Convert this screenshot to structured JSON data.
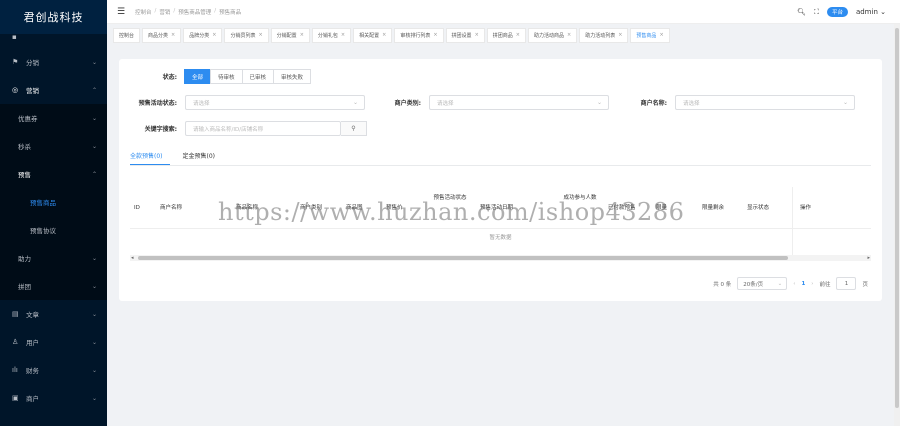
{
  "app": {
    "logo": "君创战科技"
  },
  "sidebar": {
    "items": [
      {
        "label": "分销",
        "icon": "flag-icon"
      },
      {
        "label": "营销",
        "icon": "globe-icon"
      }
    ],
    "marketing_sub": [
      {
        "label": "优惠券"
      },
      {
        "label": "秒杀"
      },
      {
        "label": "预售"
      }
    ],
    "presale_sub": [
      {
        "label": "预售商品"
      },
      {
        "label": "预售协议"
      }
    ],
    "marketing_sub2": [
      {
        "label": "助力"
      },
      {
        "label": "拼团"
      }
    ],
    "items2": [
      {
        "label": "文章",
        "icon": "article-icon"
      },
      {
        "label": "用户",
        "icon": "user-icon"
      },
      {
        "label": "财务",
        "icon": "chart-icon"
      },
      {
        "label": "商户",
        "icon": "shop-icon"
      }
    ]
  },
  "header": {
    "breadcrumb": [
      "控制台",
      "营销",
      "预售商品管理",
      "预售商品"
    ],
    "platform_badge": "平台",
    "user": "admin"
  },
  "tabs": [
    {
      "label": "控制台"
    },
    {
      "label": "商品分类"
    },
    {
      "label": "品牌分类"
    },
    {
      "label": "分销员列表"
    },
    {
      "label": "分销配置"
    },
    {
      "label": "分销礼包"
    },
    {
      "label": "相关配置"
    },
    {
      "label": "审核排行列表"
    },
    {
      "label": "拼团设置"
    },
    {
      "label": "拼团商品"
    },
    {
      "label": "助力活动商品"
    },
    {
      "label": "助力活动列表"
    },
    {
      "label": "预售商品"
    }
  ],
  "filters": {
    "status_label": "状态:",
    "status_options": [
      "全部",
      "待审核",
      "已审核",
      "审核失败"
    ],
    "activity_status_label": "预售活动状态:",
    "activity_status_placeholder": "请选择",
    "merchant_type_label": "商户类别:",
    "merchant_type_placeholder": "请选择",
    "merchant_name_label": "商户名称:",
    "merchant_name_placeholder": "请选择",
    "keyword_label": "关键字搜索:",
    "keyword_placeholder": "请输入商品名称/ID/店铺名称"
  },
  "subtabs": [
    "全款预售(0)",
    "定金预售(0)"
  ],
  "table": {
    "columns": [
      "ID",
      "商户名称",
      "商品名称",
      "商户类别",
      "商品图",
      "预售价",
      "预售活动状态",
      "预售活动日期",
      "成功参与人数",
      "已付款预售",
      "限量",
      "限量剩余",
      "显示状态",
      "操作"
    ],
    "empty_text": "暂无数据"
  },
  "pagination": {
    "total": "共 0 条",
    "page_size": "20条/页",
    "current": "1",
    "goto_label": "前往",
    "goto_value": "1",
    "page_unit": "页"
  },
  "watermark": "https://www.huzhan.com/ishop43286"
}
